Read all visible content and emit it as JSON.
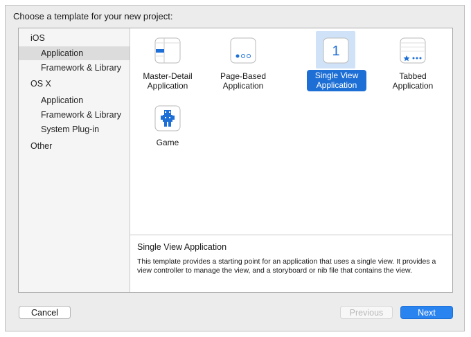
{
  "dialog": {
    "prompt": "Choose a template for your new project:"
  },
  "sidebar": {
    "items": [
      {
        "label": "iOS"
      },
      {
        "label": "Application"
      },
      {
        "label": "Framework & Library"
      },
      {
        "label": "OS X"
      },
      {
        "label": "Application"
      },
      {
        "label": "Framework & Library"
      },
      {
        "label": "System Plug-in"
      },
      {
        "label": "Other"
      }
    ],
    "selected": "Application"
  },
  "templates": [
    {
      "line1": "Master-Detail",
      "line2": "Application",
      "icon": "master-detail-icon"
    },
    {
      "line1": "Page-Based",
      "line2": "Application",
      "icon": "page-based-icon"
    },
    {
      "line1": "Single View",
      "line2": "Application",
      "icon": "single-view-icon",
      "glyph": "1",
      "selected": true
    },
    {
      "line1": "Tabbed",
      "line2": "Application",
      "icon": "tabbed-icon"
    },
    {
      "line1": "Game",
      "line2": "",
      "icon": "game-icon"
    }
  ],
  "description": {
    "title": "Single View Application",
    "text": "This template provides a starting point for an application that uses a single view. It provides a view controller to manage the view, and a storyboard or nib file that contains the view."
  },
  "buttons": {
    "cancel": "Cancel",
    "previous": "Previous",
    "next": "Next"
  },
  "colors": {
    "accent": "#1d6fd6",
    "selection_highlight": "#cfe2f7",
    "next_button": "#2a84f0"
  }
}
